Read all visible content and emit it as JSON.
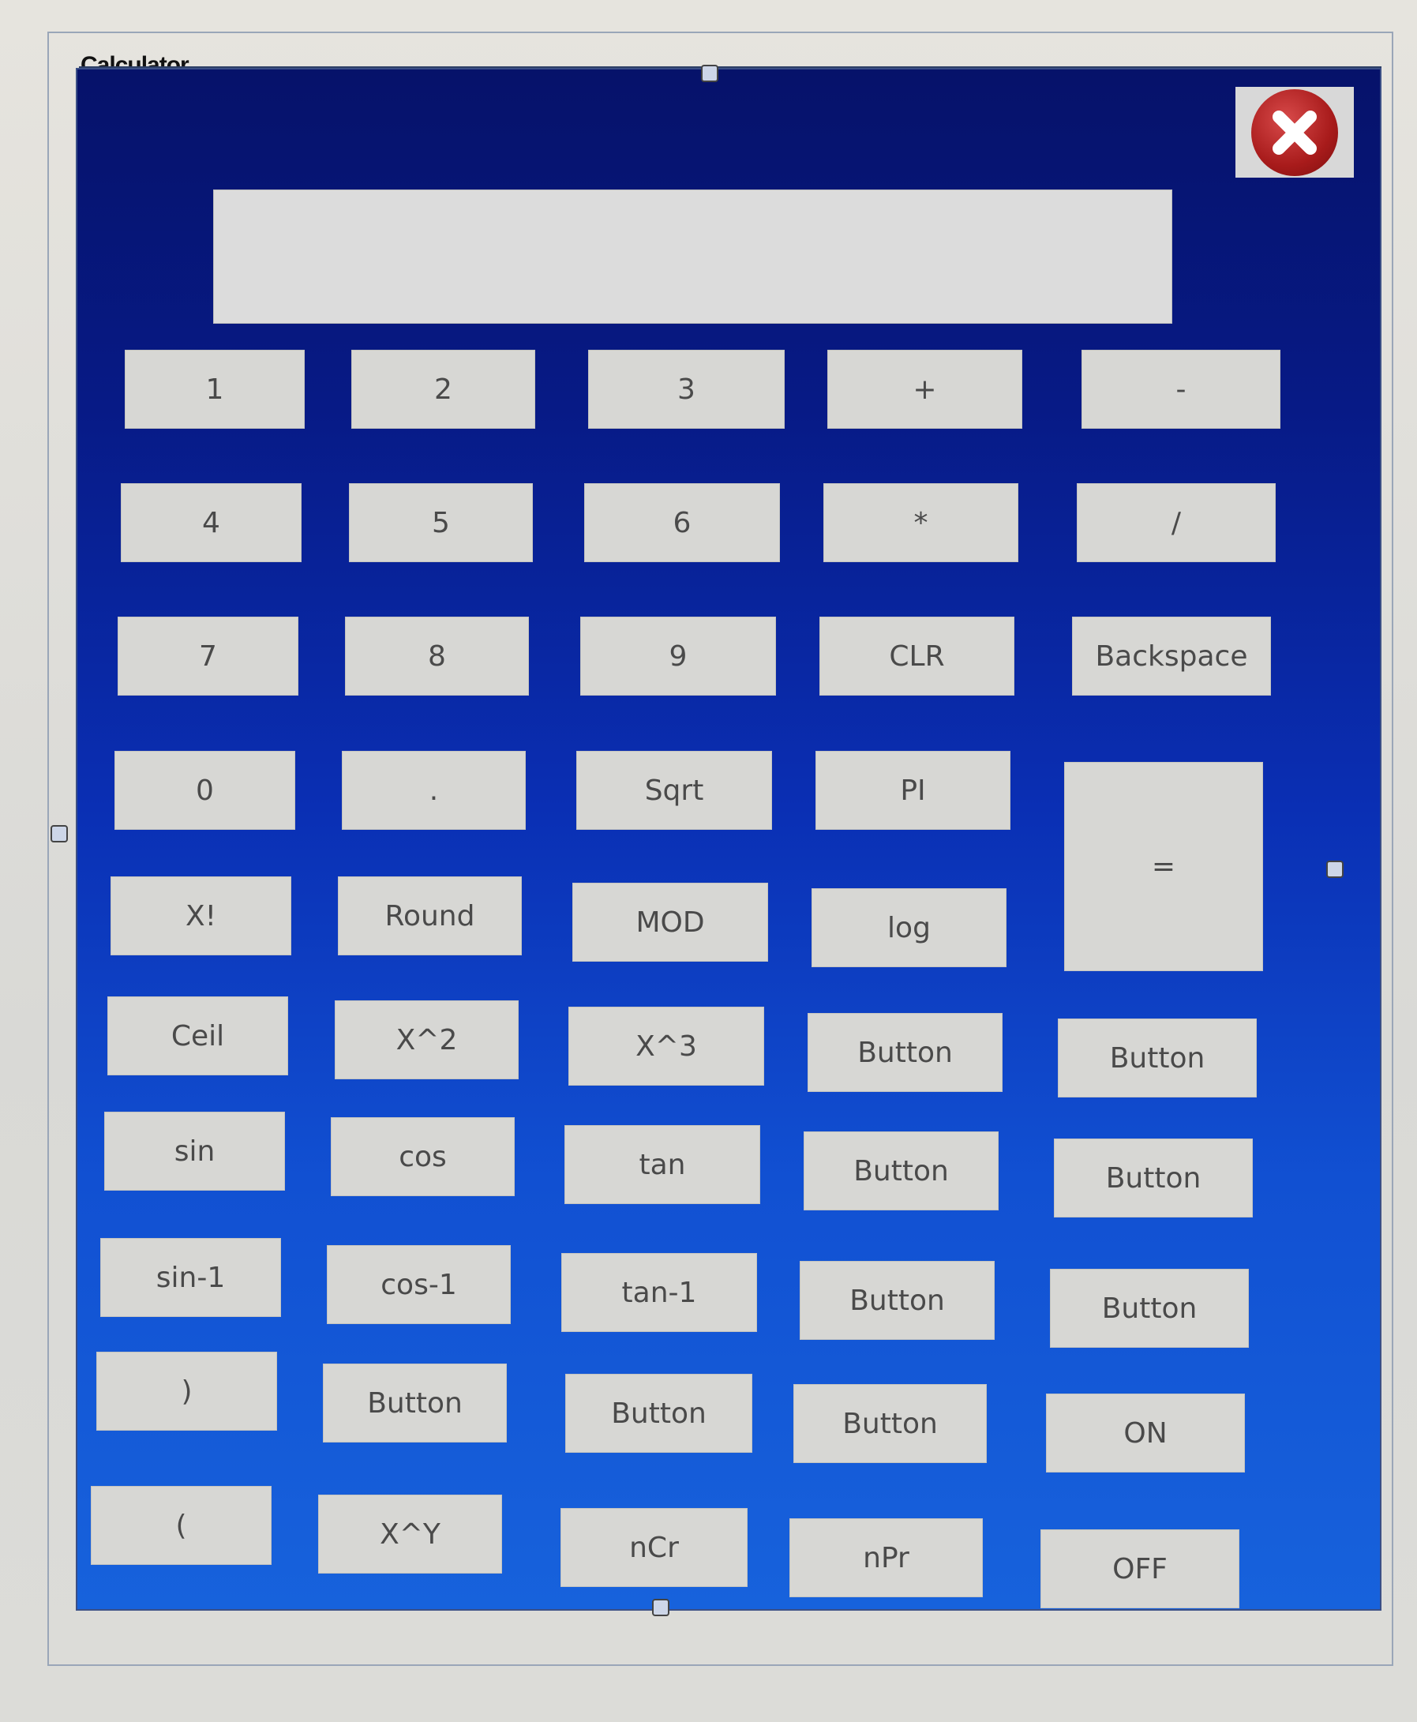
{
  "window": {
    "title": "Calculator"
  },
  "display": {
    "value": ""
  },
  "buttons": {
    "r1": [
      "1",
      "2",
      "3",
      "+",
      "-"
    ],
    "r2": [
      "4",
      "5",
      "6",
      "*",
      "/"
    ],
    "r3": [
      "7",
      "8",
      "9",
      "CLR",
      "Backspace"
    ],
    "r4": [
      "0",
      ".",
      "Sqrt",
      "PI"
    ],
    "equals": "=",
    "r5": [
      "X!",
      "Round",
      "MOD",
      "log"
    ],
    "r6": [
      "Ceil",
      "X^2",
      "X^3",
      "Button",
      "Button"
    ],
    "r7": [
      "sin",
      "cos",
      "tan",
      "Button",
      "Button"
    ],
    "r8": [
      "sin-1",
      "cos-1",
      "tan-1",
      "Button",
      "Button"
    ],
    "r9": [
      ")",
      "Button",
      "Button",
      "Button",
      "ON"
    ],
    "r10": [
      "(",
      "X^Y",
      "nCr",
      "nPr",
      "OFF"
    ]
  },
  "icons": {
    "close": "close-x-icon"
  },
  "colors": {
    "window_top": "#06126a",
    "window_bottom": "#1762dc",
    "button_face": "#d7d7d4",
    "close_red": "#a81b1b"
  }
}
